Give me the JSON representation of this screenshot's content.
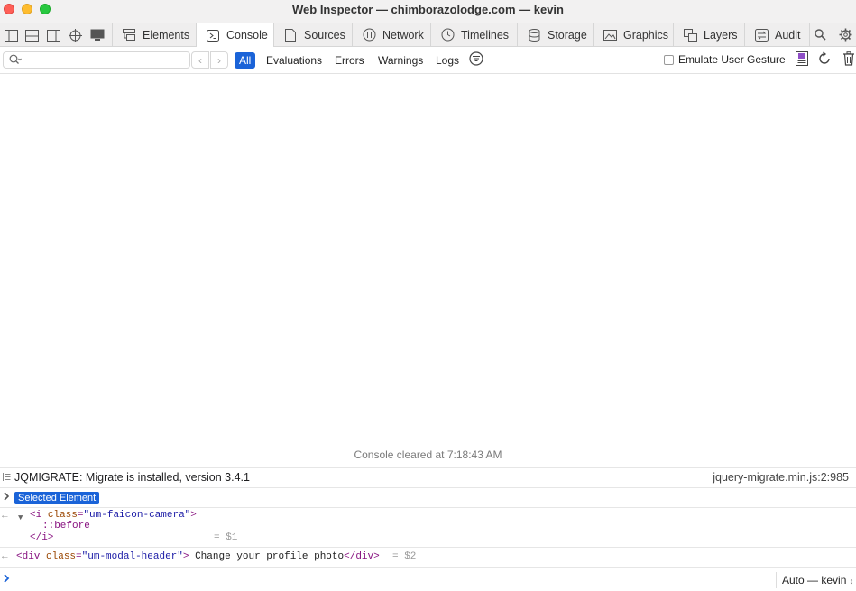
{
  "window": {
    "title": "Web Inspector — chimborazolodge.com — kevin"
  },
  "tabs": [
    {
      "label": "Elements",
      "icon": "elements-icon"
    },
    {
      "label": "Console",
      "icon": "console-icon"
    },
    {
      "label": "Sources",
      "icon": "sources-icon"
    },
    {
      "label": "Network",
      "icon": "network-icon"
    },
    {
      "label": "Timelines",
      "icon": "timelines-icon"
    },
    {
      "label": "Storage",
      "icon": "storage-icon"
    },
    {
      "label": "Graphics",
      "icon": "graphics-icon"
    },
    {
      "label": "Layers",
      "icon": "layers-icon"
    },
    {
      "label": "Audit",
      "icon": "audit-icon"
    }
  ],
  "active_tab": "Console",
  "filter": {
    "search_value": "",
    "levels": {
      "all": "All",
      "evaluations": "Evaluations",
      "errors": "Errors",
      "warnings": "Warnings",
      "logs": "Logs"
    },
    "emulate_label": "Emulate User Gesture",
    "emulate_checked": false
  },
  "console": {
    "cleared_text": "Console cleared at 7:18:43 AM",
    "messages": {
      "jqmigrate": {
        "text": "JQMIGRATE: Migrate is installed, version 3.4.1",
        "source": "jquery-migrate.min.js:2:985"
      },
      "selected": {
        "badge": "Selected Element"
      },
      "node1": {
        "open_tag": "i",
        "attr_name": "class",
        "attr_value": "\"um-faicon-camera\"",
        "pseudo": "::before",
        "close_tag": "</i>",
        "ref": "= $1"
      },
      "node2": {
        "tag": "div",
        "attr_name": "class",
        "attr_value": "\"um-modal-header\"",
        "text": " Change your profile photo",
        "close_tag": "</div>",
        "ref": "= $2"
      }
    },
    "context": "Auto — kevin"
  },
  "colors": {
    "accent": "#1a63d8",
    "close": "#fe5f57",
    "minimize": "#febc2e",
    "zoom": "#28c840"
  }
}
